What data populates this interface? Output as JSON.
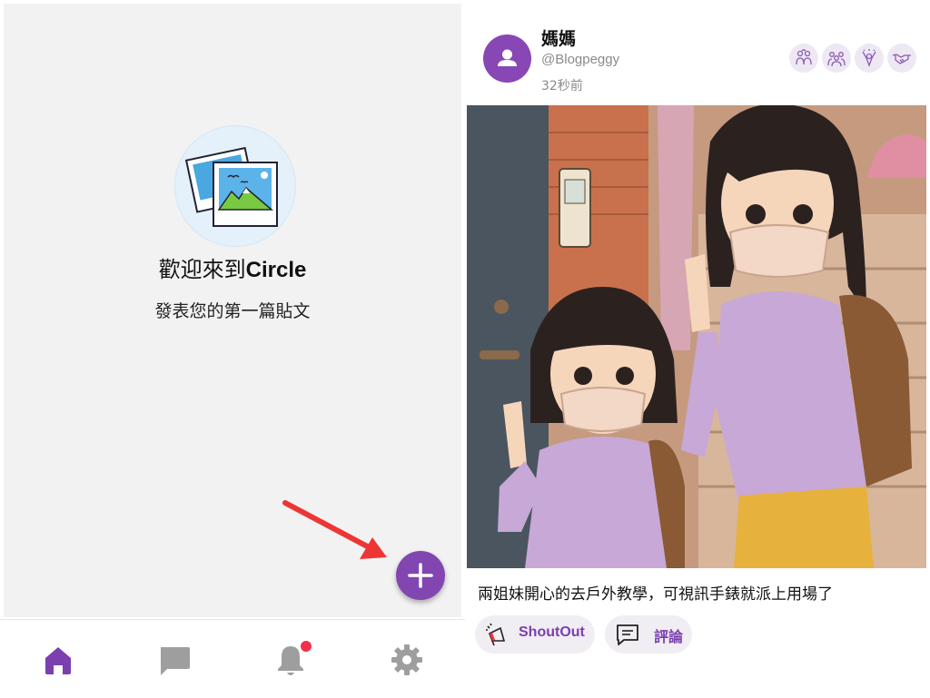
{
  "welcome": {
    "title_prefix": "歡迎來到",
    "title_brand": "Circle",
    "subtitle": "發表您的第一篇貼文"
  },
  "fab": {
    "icon": "plus-icon"
  },
  "bottom_nav": {
    "items": [
      {
        "icon": "home-icon",
        "active": true
      },
      {
        "icon": "chat-icon",
        "active": false
      },
      {
        "icon": "bell-icon",
        "active": false,
        "badge": true
      },
      {
        "icon": "gear-icon",
        "active": false
      }
    ]
  },
  "post": {
    "author_name": "媽媽",
    "author_handle": "@Blogpeggy",
    "time": "32秒前",
    "reactions": [
      "family-icon",
      "group-icon",
      "celebrate-icon",
      "handshake-icon"
    ],
    "caption": "兩姐妹開心的去戶外教學，可視訊手錶就派上用場了",
    "actions": {
      "shoutout_label": "ShoutOut",
      "comment_label": "評論"
    }
  },
  "colors": {
    "accent": "#8246b0",
    "nav_active": "#7b3fae",
    "nav_inactive": "#9e9e9e",
    "badge": "#f0314a",
    "panel_bg": "#f2f2f2"
  }
}
